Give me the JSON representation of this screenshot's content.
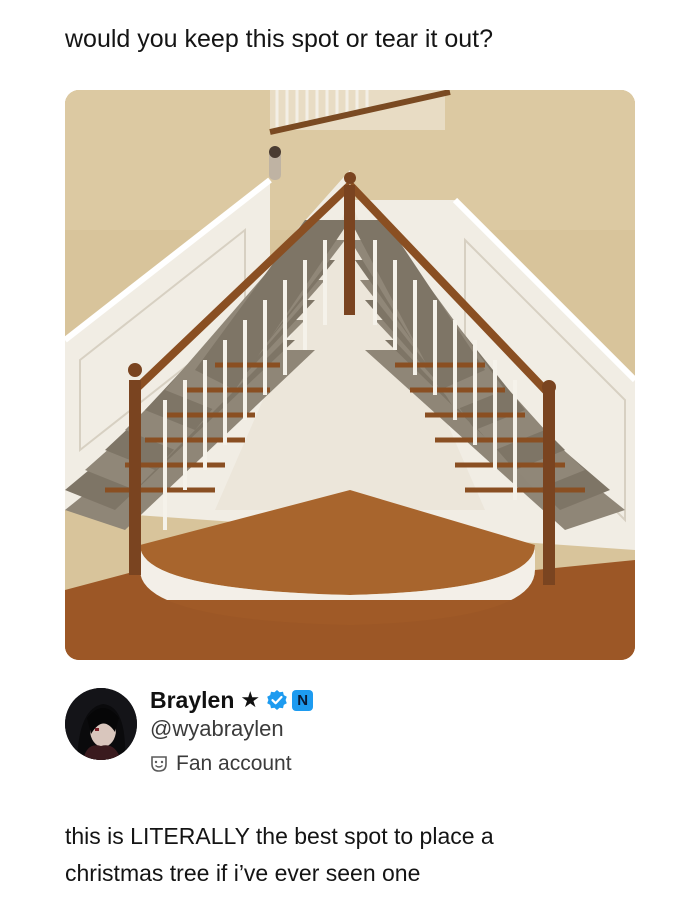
{
  "post": {
    "caption": "would you keep this spot or tear it out?"
  },
  "author": {
    "display_name": "Braylen",
    "handle": "@wyabraylen",
    "account_label": "Fan account",
    "name_suffix_icon": "star-icon",
    "verified_color": "#1d9bf0",
    "badge_icon": "n-logo-badge"
  },
  "tweet": {
    "line1": "this is LITERALLY the best spot to place a",
    "line2": "christmas tree if i’ve ever seen one"
  }
}
